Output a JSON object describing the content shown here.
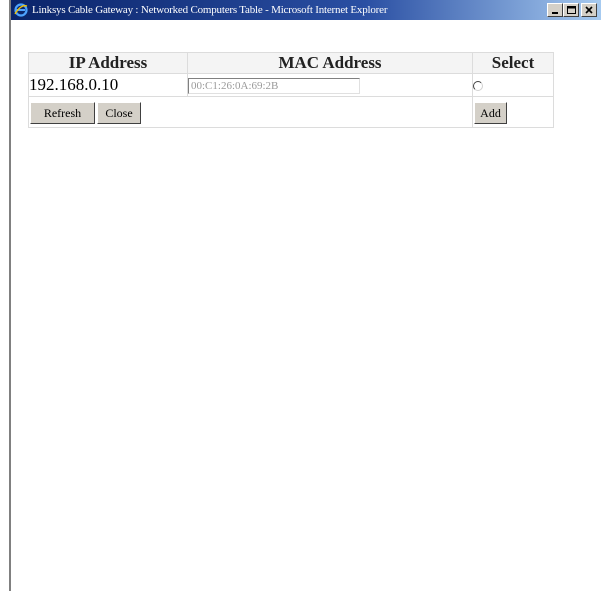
{
  "window": {
    "title": "Linksys Cable Gateway : Networked Computers Table - Microsoft Internet Explorer",
    "icons": [
      "ie-icon",
      "minimize-icon",
      "maximize-icon",
      "close-icon"
    ]
  },
  "table": {
    "headers": [
      "IP Address",
      "MAC Address",
      "Select"
    ],
    "rows": [
      {
        "ip": "192.168.0.10",
        "mac": "00:C1:26:0A:69:2B",
        "selected": false
      }
    ]
  },
  "buttons": {
    "refresh": "Refresh",
    "close": "Close",
    "add": "Add"
  }
}
